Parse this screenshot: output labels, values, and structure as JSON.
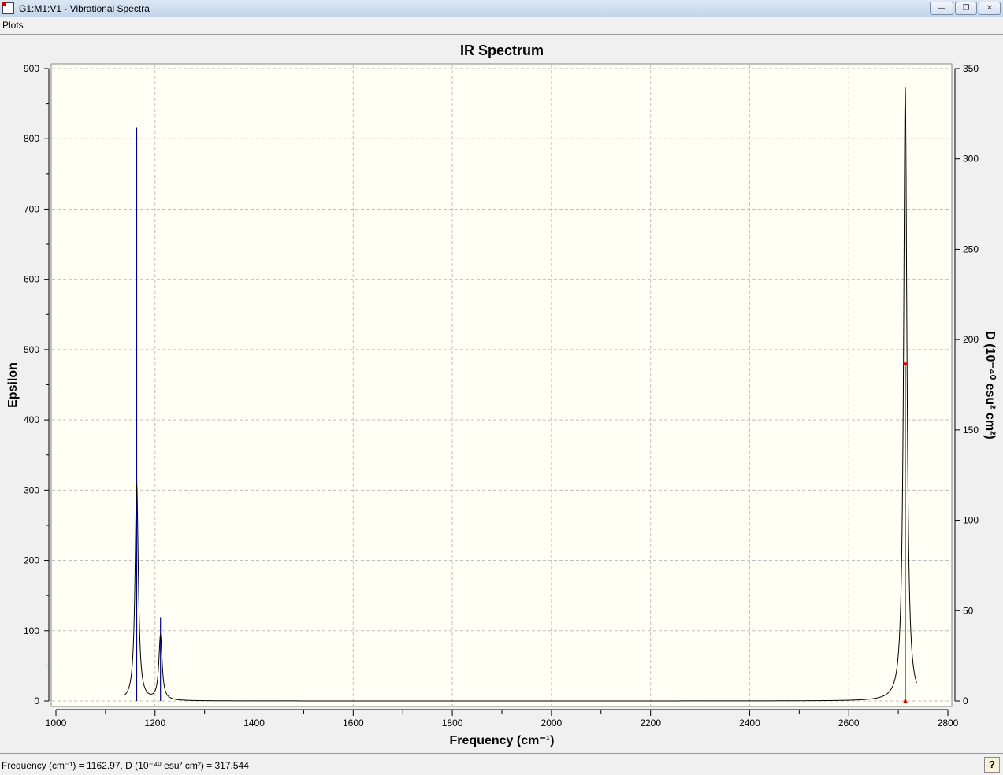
{
  "window": {
    "title": "G1:M1:V1 - Vibrational Spectra",
    "minimize": "—",
    "restore": "❐",
    "close": "✕"
  },
  "menu": {
    "plots": "Plots"
  },
  "status": {
    "text": "Frequency (cm⁻¹) = 1162.97, D (10⁻⁴⁰ esu² cm²) = 317.544",
    "help": "?"
  },
  "chart_data": {
    "type": "line",
    "title": "IR Spectrum",
    "xlabel": "Frequency (cm⁻¹)",
    "ylabel": "Epsilon",
    "y2label": "D (10⁻⁴⁰ esu² cm²)",
    "xlim": [
      1000,
      2800
    ],
    "ylim": [
      0,
      900
    ],
    "y2lim": [
      0,
      350
    ],
    "xticks": [
      "1000",
      "1200",
      "1400",
      "1600",
      "1800",
      "2000",
      "2200",
      "2400",
      "2600",
      "2800"
    ],
    "yticks": [
      "0",
      "100",
      "200",
      "300",
      "400",
      "500",
      "600",
      "700",
      "800",
      "900"
    ],
    "y2ticks": [
      "0",
      "50",
      "100",
      "150",
      "200",
      "250",
      "300",
      "350"
    ],
    "grid": true,
    "spectrum_range": [
      1137,
      2737
    ],
    "hwhm": 4,
    "spectrum_peaks": [
      {
        "x": 1163,
        "epsilon": 308
      },
      {
        "x": 1211,
        "epsilon": 92
      },
      {
        "x": 2714,
        "epsilon": 873
      }
    ],
    "sticks": [
      {
        "x": 1162.97,
        "D": 317.544
      },
      {
        "x": 1211,
        "D": 46
      },
      {
        "x": 2714,
        "D": 186
      }
    ],
    "selected_stick": 2,
    "colors": {
      "spectrum": "#000000",
      "sticks": "#00008b",
      "marker": "#e00000",
      "plot_bg": "#fffff6",
      "grid": "#c0c0c0"
    }
  }
}
